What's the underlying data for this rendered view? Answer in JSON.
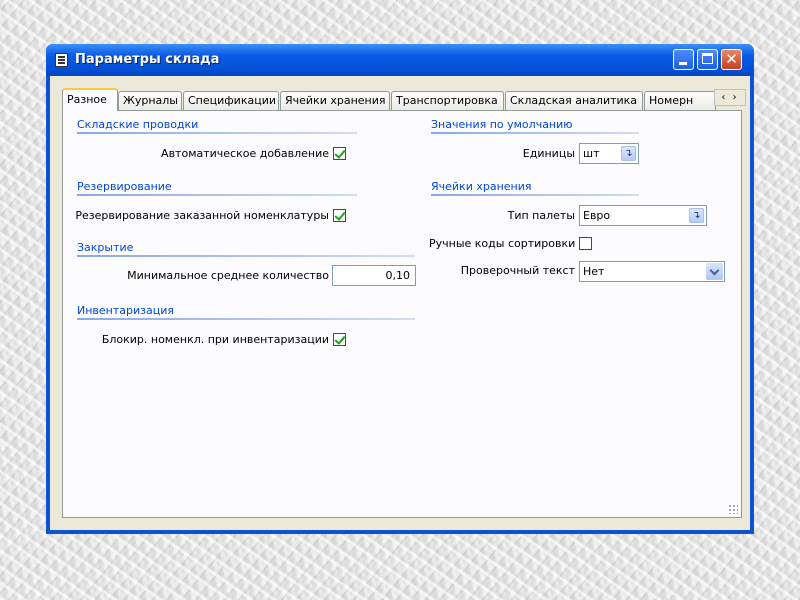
{
  "window": {
    "title": "Параметры склада",
    "icon": "form-icon"
  },
  "tabs": [
    {
      "label": "Разное",
      "active": true
    },
    {
      "label": "Журналы"
    },
    {
      "label": "Спецификации"
    },
    {
      "label": "Ячейки хранения"
    },
    {
      "label": "Транспортировка"
    },
    {
      "label": "Складская аналитика"
    },
    {
      "label": "Номерн"
    }
  ],
  "tab_scroll": "‹ ›",
  "left": {
    "postings": {
      "heading": "Складские проводки",
      "auto_add_label": "Автоматическое добавление",
      "auto_add_checked": true
    },
    "reservation": {
      "heading": "Резервирование",
      "reserve_label": "Резервирование заказанной номенклатуры",
      "reserve_checked": true
    },
    "closing": {
      "heading": "Закрытие",
      "min_qty_label": "Минимальное среднее количество",
      "min_qty_value": "0,10"
    },
    "inventory": {
      "heading": "Инвентаризация",
      "block_label": "Блокир. номенкл. при инвентаризации",
      "block_checked": true
    }
  },
  "right": {
    "defaults": {
      "heading": "Значения по умолчанию",
      "units_label": "Единицы",
      "units_value": "шт"
    },
    "cells": {
      "heading": "Ячейки хранения",
      "pallet_label": "Тип палеты",
      "pallet_value": "Евро",
      "manual_codes_label": "Ручные коды сортировки",
      "manual_codes_checked": false,
      "check_text_label": "Проверочный текст",
      "check_text_value": "Нет"
    }
  },
  "colors": {
    "titlebar": "#0b5ce6",
    "section_heading": "#0046d5",
    "check_mark": "#21a121",
    "active_tab_accent": "#ffc83c"
  }
}
